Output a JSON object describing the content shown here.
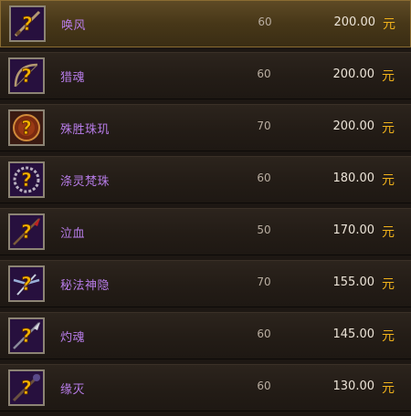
{
  "items": [
    {
      "name": "唤风",
      "level": "60",
      "price": "200.00",
      "currency": "元",
      "icon": "unidentified-weapon-icon"
    },
    {
      "name": "猎魂",
      "level": "60",
      "price": "200.00",
      "currency": "元",
      "icon": "unidentified-bow-icon"
    },
    {
      "name": "殊胜珠玑",
      "level": "70",
      "price": "200.00",
      "currency": "元",
      "icon": "unidentified-orb-icon"
    },
    {
      "name": "涤灵梵珠",
      "level": "60",
      "price": "180.00",
      "currency": "元",
      "icon": "unidentified-beads-icon"
    },
    {
      "name": "泣血",
      "level": "50",
      "price": "170.00",
      "currency": "元",
      "icon": "unidentified-spear-icon"
    },
    {
      "name": "秘法神隐",
      "level": "70",
      "price": "155.00",
      "currency": "元",
      "icon": "unidentified-crossbow-icon"
    },
    {
      "name": "灼魂",
      "level": "60",
      "price": "145.00",
      "currency": "元",
      "icon": "unidentified-spear-icon"
    },
    {
      "name": "缘灭",
      "level": "60",
      "price": "130.00",
      "currency": "元",
      "icon": "unidentified-staff-icon"
    }
  ],
  "selected_index": 0,
  "colors": {
    "name": "#b77ce8",
    "price": "#ece4d8",
    "currency": "#f0b21b",
    "selected": "#5e4a25"
  }
}
